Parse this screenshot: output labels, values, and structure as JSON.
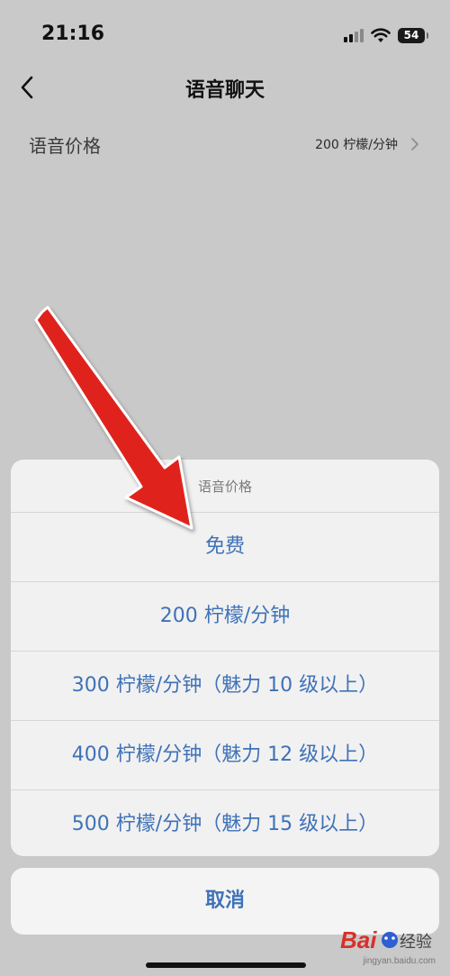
{
  "status_bar": {
    "time": "21:16",
    "battery_level": "54"
  },
  "nav": {
    "title": "语音聊天"
  },
  "setting": {
    "label": "语音价格",
    "value": "200 柠檬/分钟"
  },
  "action_sheet": {
    "title": "语音价格",
    "options": [
      "免费",
      "200 柠檬/分钟",
      "300 柠檬/分钟（魅力 10 级以上）",
      "400 柠檬/分钟（魅力 12 级以上）",
      "500 柠檬/分钟（魅力 15 级以上）"
    ],
    "cancel_label": "取消"
  },
  "colors": {
    "overlay_background": "#c9c9c9",
    "sheet_background": "#f1f1f1",
    "option_text": "#3f72b8",
    "annotation_arrow": "#e0201a"
  },
  "watermark": {
    "logo_text": "Bai经验",
    "url": "jingyan.baidu.com"
  }
}
